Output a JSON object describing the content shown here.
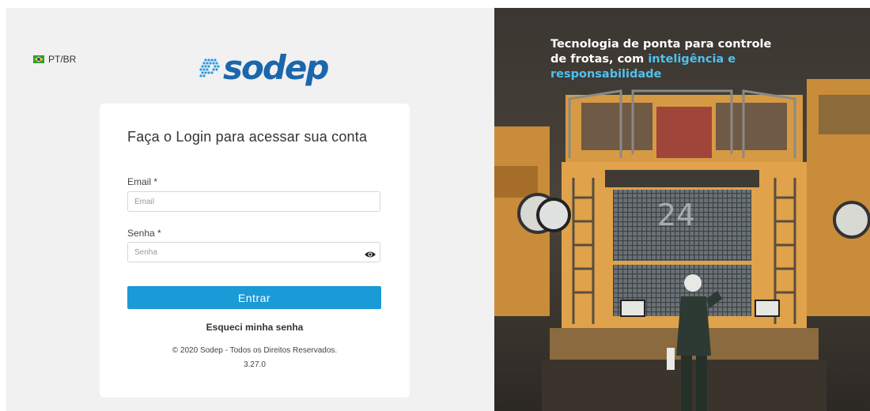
{
  "language": {
    "label": "PT/BR"
  },
  "brand": {
    "name": "sodep"
  },
  "login": {
    "title": "Faça o Login para acessar sua conta",
    "email_label": "Email *",
    "email_placeholder": "Email",
    "password_label": "Senha *",
    "password_placeholder": "Senha",
    "submit_label": "Entrar",
    "forgot_label": "Esqueci minha senha",
    "copyright": "© 2020 Sodep - Todos os Direitos Reservados.",
    "version": "3.27.0"
  },
  "hero": {
    "headline_part1": "Tecnologia de ponta para controle de frotas, com ",
    "headline_accent": "inteligência e responsabilidade",
    "truck_number": "24"
  },
  "colors": {
    "brand_blue": "#1b66ad",
    "button_blue": "#1a9ad6",
    "accent_cyan": "#4fc1ef",
    "panel_gray": "#f1f1f1"
  },
  "icons": {
    "flag": "brazil-flag-icon",
    "logo_mark": "dots-logo-icon",
    "password_toggle": "eye-icon"
  }
}
